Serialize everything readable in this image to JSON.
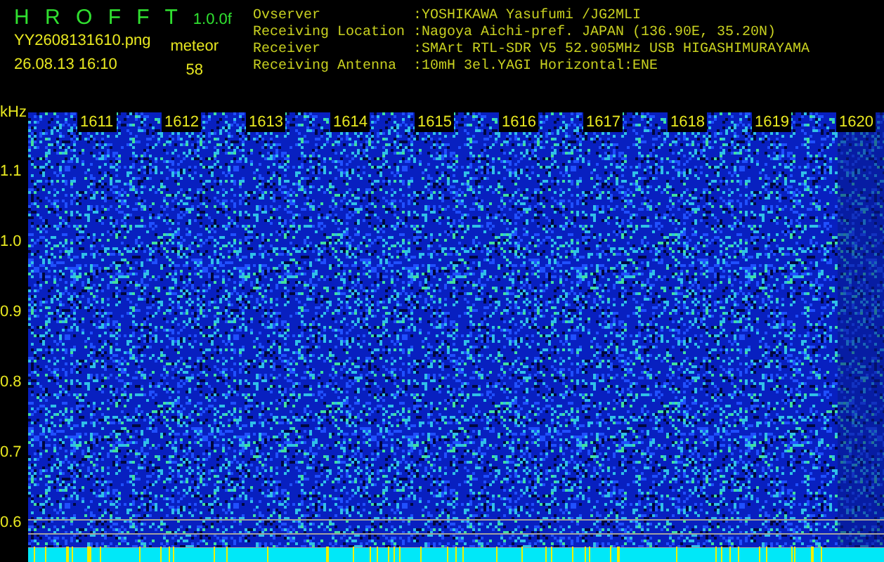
{
  "app": {
    "logo": "H R O F F T",
    "version": "1.0.0f",
    "filename": "YY2608131610.png",
    "datetime": "26.08.13 16:10",
    "count_label": "meteor",
    "count": "58"
  },
  "info": [
    {
      "label": "Ovserver",
      "value": ":YOSHIKAWA Yasufumi /JG2MLI"
    },
    {
      "label": "Receiving Location",
      "value": ":Nagoya Aichi-pref. JAPAN (136.90E, 35.20N)"
    },
    {
      "label": "Receiver",
      "value": ":SMArt RTL-SDR V5 52.905MHz USB HIGASHIMURAYAMA"
    },
    {
      "label": "Receiving Antenna",
      "value": ":10mH 3el.YAGI Horizontal:ENE"
    }
  ],
  "spectrogram": {
    "y_unit": "kHz",
    "y_labels": [
      "1.1",
      "1.0",
      "0.9",
      "0.8",
      "0.7",
      "0.6"
    ],
    "x_labels": [
      "1611",
      "1612",
      "1613",
      "1614",
      "1615",
      "1616",
      "1617",
      "1618",
      "1619",
      "1620"
    ]
  }
}
